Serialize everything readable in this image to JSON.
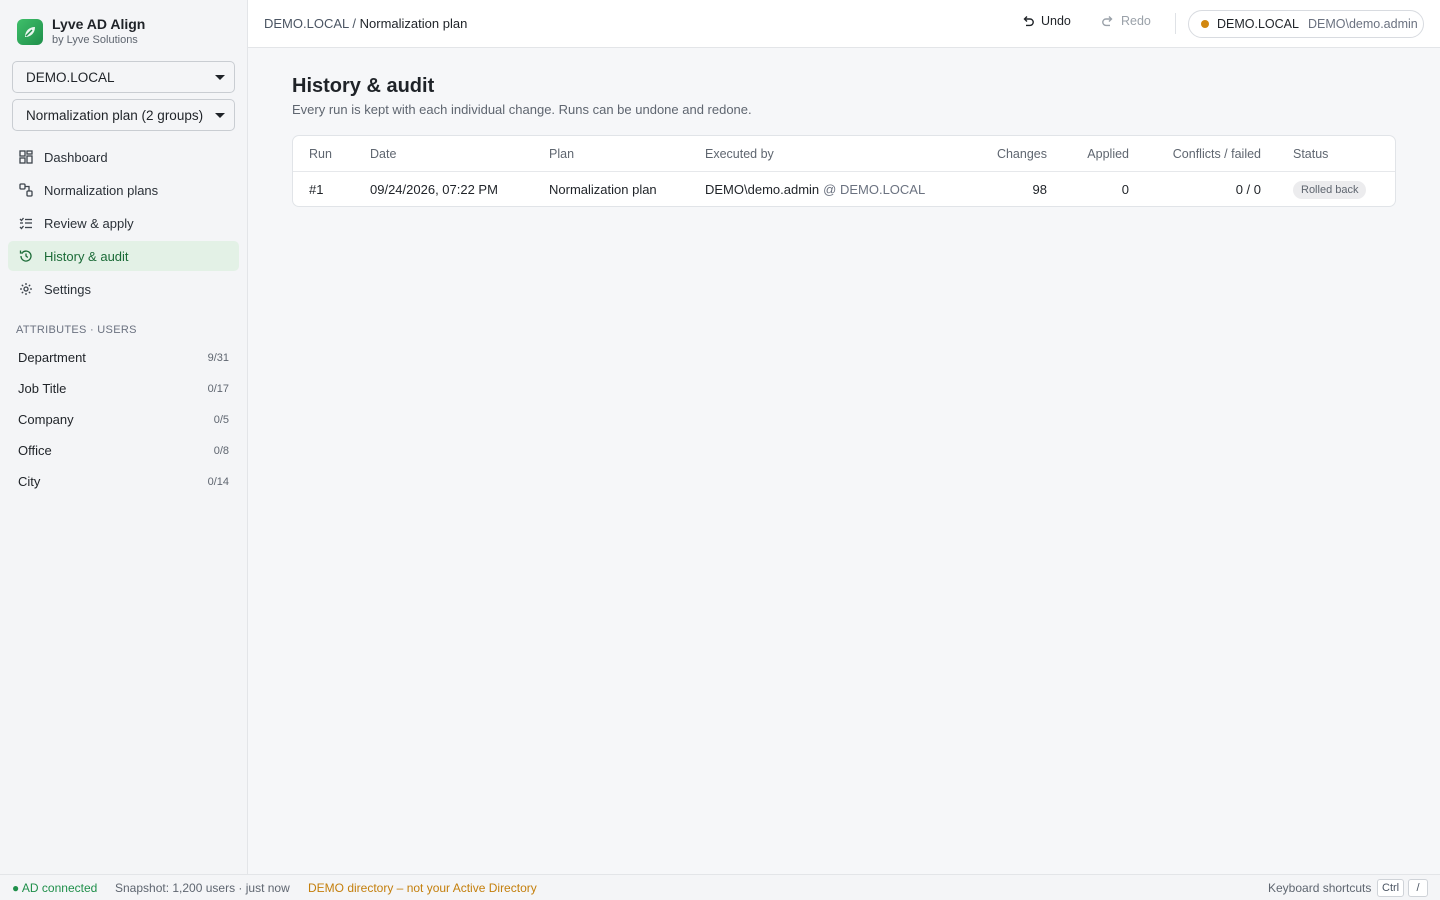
{
  "brand": {
    "title": "Lyve AD Align",
    "subtitle": "by Lyve Solutions"
  },
  "selectors": {
    "domain": "DEMO.LOCAL",
    "plan": "Normalization plan (2 groups)"
  },
  "nav": [
    {
      "label": "Dashboard",
      "icon": "dashboard-icon"
    },
    {
      "label": "Normalization plans",
      "icon": "plans-icon"
    },
    {
      "label": "Review & apply",
      "icon": "checklist-icon"
    },
    {
      "label": "History & audit",
      "icon": "history-icon",
      "active": true
    },
    {
      "label": "Settings",
      "icon": "gear-icon"
    }
  ],
  "attributes": {
    "section_label": "ATTRIBUTES · USERS",
    "items": [
      {
        "label": "Department",
        "count": "9/31"
      },
      {
        "label": "Job Title",
        "count": "0/17"
      },
      {
        "label": "Company",
        "count": "0/5"
      },
      {
        "label": "Office",
        "count": "0/8"
      },
      {
        "label": "City",
        "count": "0/14"
      }
    ]
  },
  "header": {
    "breadcrumb_root": "DEMO.LOCAL",
    "breadcrumb_sep": "/",
    "breadcrumb_current": "Normalization plan",
    "undo_label": "Undo",
    "redo_label": "Redo",
    "connection_domain": "DEMO.LOCAL",
    "connection_user": "DEMO\\demo.admin",
    "connection_status_color": "#d1870f"
  },
  "page": {
    "title": "History & audit",
    "subtitle": "Every run is kept with each individual change. Runs can be undone and redone."
  },
  "table": {
    "columns": {
      "run": "Run",
      "date": "Date",
      "plan": "Plan",
      "executed_by": "Executed by",
      "changes": "Changes",
      "applied": "Applied",
      "conflicts": "Conflicts / failed",
      "status": "Status"
    },
    "rows": [
      {
        "run": "#1",
        "date": "09/24/2026, 07:22 PM",
        "plan": "Normalization plan",
        "executed_by_user": "DEMO\\demo.admin",
        "executed_by_domain": "@ DEMO.LOCAL",
        "changes": "98",
        "applied": "0",
        "conflicts": "0 / 0",
        "status": "Rolled back"
      }
    ]
  },
  "statusbar": {
    "connection": "● AD connected",
    "snapshot": "Snapshot: 1,200 users · just now",
    "warning": "DEMO directory – not your Active Directory",
    "shortcuts_label": "Keyboard shortcuts",
    "key1": "Ctrl",
    "key2": "/"
  },
  "colors": {
    "accent": "#1f8f4a",
    "active_nav_bg": "#e3f1e6",
    "warning": "#c47f0c"
  }
}
